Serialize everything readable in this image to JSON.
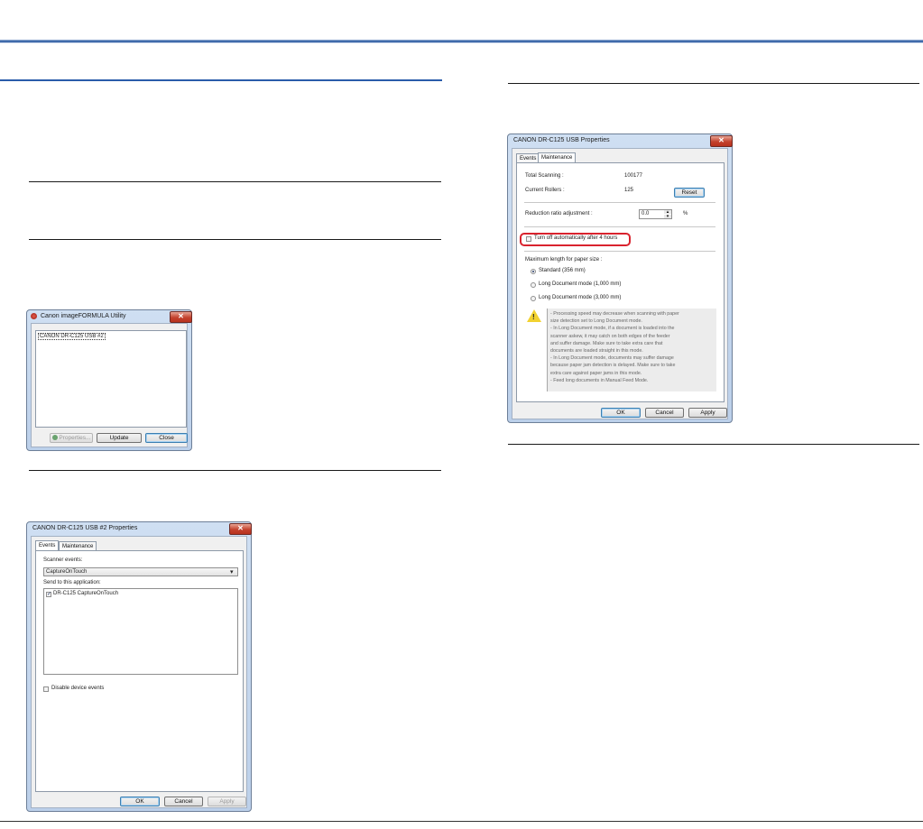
{
  "utility_window": {
    "title": "Canon imageFORMULA Utility",
    "close_glyph": "✕",
    "list_items": [
      "CANON DR-C125 USB #2"
    ],
    "buttons": {
      "properties": "Properties...",
      "update": "Update",
      "close": "Close"
    }
  },
  "events_window": {
    "title": "CANON DR-C125 USB #2 Properties",
    "close_glyph": "✕",
    "tabs": [
      "Events",
      "Maintenance"
    ],
    "scanner_events_label": "Scanner events:",
    "scanner_events_value": "CaptureOnTouch",
    "dropdown_glyph": "▾",
    "send_to_label": "Send to this application:",
    "applications": [
      {
        "label": "DR-C125 CaptureOnTouch",
        "checked": true
      }
    ],
    "check_glyph": "✓",
    "disable_events_label": "Disable device events",
    "buttons": {
      "ok": "OK",
      "cancel": "Cancel",
      "apply": "Apply"
    }
  },
  "maintenance_window": {
    "title": "CANON DR-C125 USB Properties",
    "close_glyph": "✕",
    "tabs": [
      "Events",
      "Maintenance"
    ],
    "total_scanning_label": "Total Scanning :",
    "total_scanning_value": "100177",
    "current_rollers_label": "Current Rollers :",
    "current_rollers_value": "125",
    "reset_button": "Reset",
    "reduction_label": "Reduction ratio adjustment :",
    "reduction_value": "0.0",
    "spin_up": "▴",
    "spin_down": "▾",
    "reduction_unit": "%",
    "auto_off_label": "Turn off automatically after 4 hours",
    "auto_off_checked": false,
    "highlight_color": "#d9232e",
    "max_length_label": "Maximum length for paper size :",
    "paper_options": [
      {
        "label": "Standard (356 mm)",
        "selected": true
      },
      {
        "label": "Long Document mode (1,000 mm)",
        "selected": false
      },
      {
        "label": "Long Document mode (3,000 mm)",
        "selected": false
      }
    ],
    "warning_glyph": "!",
    "warning_lines": [
      "- Processing speed may decrease when scanning with paper",
      "size detection set to Long Document mode.",
      "- In Long Document mode, if a document is loaded into the",
      "scanner askew, it may catch on both edges of the feeder",
      "and suffer damage. Make sure to take extra care that",
      "documents are loaded straight in this mode.",
      "- In Long Document mode, documents may suffer damage",
      "because paper jam detection is delayed. Make sure to take",
      "extra care against paper jams in this mode.",
      "- Feed long documents in Manual Feed Mode."
    ],
    "buttons": {
      "ok": "OK",
      "cancel": "Cancel",
      "apply": "Apply"
    }
  }
}
